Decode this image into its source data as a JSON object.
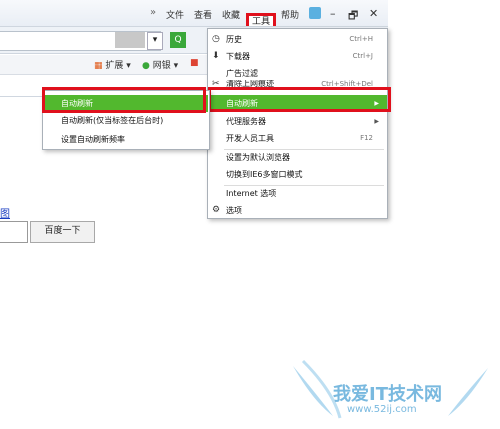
{
  "menubar": {
    "chevrons": "»",
    "file": "文件",
    "view": "查看",
    "favorites": "收藏",
    "tools": "工具",
    "help": "帮助",
    "minimize": "–",
    "restore": "🗗",
    "close": "✕"
  },
  "toolbar": {
    "extensions": "扩展",
    "netbank": "网银",
    "more": "▾"
  },
  "page": {
    "image_link": "图",
    "search_button": "百度一下"
  },
  "tools_menu": {
    "items": [
      {
        "label": "历史",
        "shortcut": "Ctrl+H"
      },
      {
        "label": "下载器",
        "shortcut": "Ctrl+J"
      },
      {
        "label": "广告过滤",
        "shortcut": ""
      },
      {
        "label": "清除上网痕迹",
        "shortcut": "Ctrl+Shift+Del"
      },
      {
        "label": "自动刷新",
        "shortcut": ""
      },
      {
        "label": "代理服务器",
        "shortcut": ""
      },
      {
        "label": "开发人员工具",
        "shortcut": "F12"
      },
      {
        "label": "设置为默认浏览器",
        "shortcut": ""
      },
      {
        "label": "切换到IE6多窗口模式",
        "shortcut": ""
      },
      {
        "label": "Internet 选项",
        "shortcut": ""
      },
      {
        "label": "选项",
        "shortcut": ""
      }
    ]
  },
  "auto_refresh_submenu": {
    "items": [
      {
        "label": "自动刷新"
      },
      {
        "label": "自动刷新(仅当标签在后台时)"
      },
      {
        "label": "设置自动刷新频率"
      }
    ]
  },
  "watermark": {
    "text": "我爱IT技术网",
    "url": "www.52ij.com"
  }
}
